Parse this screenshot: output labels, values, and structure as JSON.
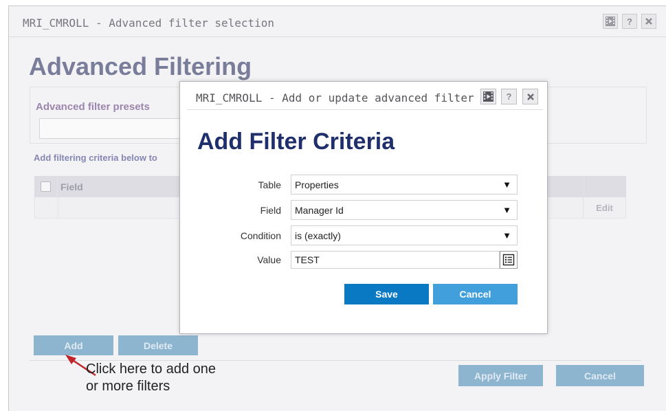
{
  "background_window": {
    "title": "MRI_CMROLL - Advanced filter selection",
    "heading": "Advanced Filtering",
    "presets_label": "Advanced filter presets",
    "criteria_text": "Add filtering criteria below to",
    "table_headers": {
      "field": "Field"
    },
    "edit_label": "Edit",
    "add_label": "Add",
    "delete_label": "Delete",
    "apply_filter_label": "Apply Filter",
    "cancel_label": "Cancel",
    "help_label": "?"
  },
  "modal": {
    "title": "MRI_CMROLL - Add or update advanced filter",
    "help_label": "?",
    "heading": "Add Filter Criteria",
    "fields": {
      "table": {
        "label": "Table",
        "value": "Properties"
      },
      "field": {
        "label": "Field",
        "value": "Manager Id"
      },
      "condition": {
        "label": "Condition",
        "value": "is (exactly)"
      },
      "value": {
        "label": "Value",
        "value": "TEST"
      }
    },
    "save_label": "Save",
    "cancel_label": "Cancel",
    "caret": "▼"
  },
  "annotation": {
    "line1": "Click here to add one",
    "line2": "or more filters"
  },
  "colors": {
    "heading_dark": "#1f2f6b",
    "save_button": "#0a79c4",
    "cancel_button": "#41a0dc",
    "arrow": "#c0252b"
  }
}
